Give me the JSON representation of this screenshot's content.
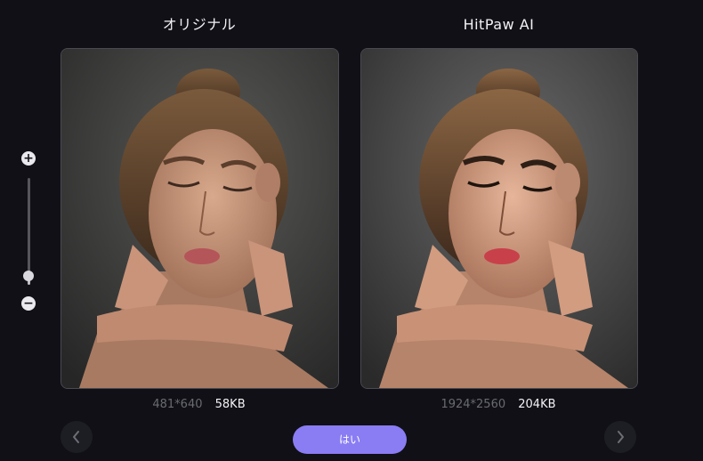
{
  "left_panel": {
    "title": "オリジナル",
    "dimensions": "481*640",
    "file_size": "58KB"
  },
  "right_panel": {
    "title": "HitPaw AI",
    "dimensions": "1924*2560",
    "file_size": "204KB"
  },
  "zoom": {
    "plus_label": "+",
    "minus_label": "−",
    "level": 0.08
  },
  "actions": {
    "yes_label": "はい"
  },
  "icons": {
    "prev": "chevron-left-icon",
    "next": "chevron-right-icon",
    "zoom_in": "zoom-in-icon",
    "zoom_out": "zoom-out-icon"
  },
  "colors": {
    "background": "#101016",
    "accent": "#8a7cf3",
    "frame_border": "#4a4a52"
  }
}
